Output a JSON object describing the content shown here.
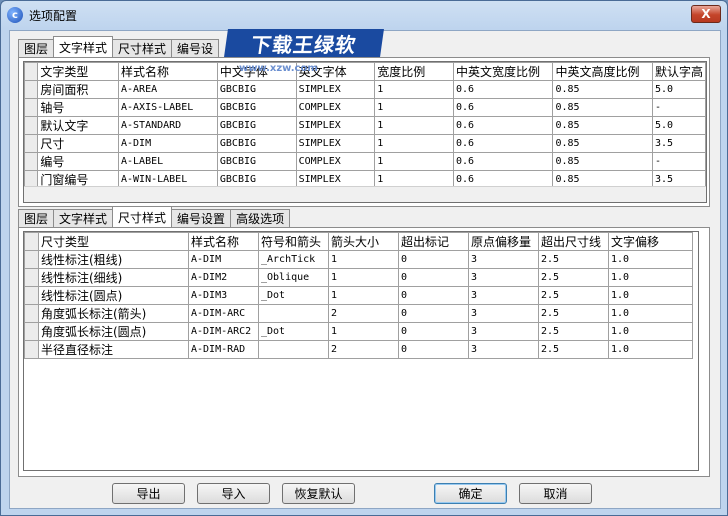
{
  "window": {
    "title": "选项配置",
    "close_label": "X",
    "app_icon": "c"
  },
  "watermark": {
    "text": "下载王绿软",
    "url": "www.xzw.com"
  },
  "top_tabs": [
    "图层",
    "文字样式",
    "尺寸样式",
    "编号设"
  ],
  "text_table": {
    "headers": [
      "文字类型",
      "样式名称",
      "中文字体",
      "英文字体",
      "宽度比例",
      "中英文宽度比例",
      "中英文高度比例",
      "默认字高"
    ],
    "rows": [
      [
        "房间面积",
        "A-AREA",
        "GBCBIG",
        "SIMPLEX",
        "1",
        "0.6",
        "0.85",
        "5.0"
      ],
      [
        "轴号",
        "A-AXIS-LABEL",
        "GBCBIG",
        "COMPLEX",
        "1",
        "0.6",
        "0.85",
        "-"
      ],
      [
        "默认文字",
        "A-STANDARD",
        "GBCBIG",
        "SIMPLEX",
        "1",
        "0.6",
        "0.85",
        "5.0"
      ],
      [
        "尺寸",
        "A-DIM",
        "GBCBIG",
        "SIMPLEX",
        "1",
        "0.6",
        "0.85",
        "3.5"
      ],
      [
        "编号",
        "A-LABEL",
        "GBCBIG",
        "COMPLEX",
        "1",
        "0.6",
        "0.85",
        "-"
      ],
      [
        "门窗编号",
        "A-WIN-LABEL",
        "GBCBIG",
        "SIMPLEX",
        "1",
        "0.6",
        "0.85",
        "3.5"
      ]
    ]
  },
  "bottom_tabs": [
    "图层",
    "文字样式",
    "尺寸样式",
    "编号设置",
    "高级选项"
  ],
  "dim_table": {
    "headers": [
      "尺寸类型",
      "样式名称",
      "符号和箭头",
      "箭头大小",
      "超出标记",
      "原点偏移量",
      "超出尺寸线",
      "文字偏移"
    ],
    "rows": [
      [
        "线性标注(粗线)",
        "A-DIM",
        "_ArchTick",
        "1",
        "0",
        "3",
        "2.5",
        "1.0"
      ],
      [
        "线性标注(细线)",
        "A-DIM2",
        "_Oblique",
        "1",
        "0",
        "3",
        "2.5",
        "1.0"
      ],
      [
        "线性标注(圆点)",
        "A-DIM3",
        "_Dot",
        "1",
        "0",
        "3",
        "2.5",
        "1.0"
      ],
      [
        "角度弧长标注(箭头)",
        "A-DIM-ARC",
        "",
        "2",
        "0",
        "3",
        "2.5",
        "1.0"
      ],
      [
        "角度弧长标注(圆点)",
        "A-DIM-ARC2",
        "_Dot",
        "1",
        "0",
        "3",
        "2.5",
        "1.0"
      ],
      [
        "半径直径标注",
        "A-DIM-RAD",
        "",
        "2",
        "0",
        "3",
        "2.5",
        "1.0"
      ]
    ]
  },
  "buttons": {
    "export": "导出",
    "import": "导入",
    "restore": "恢复默认",
    "ok": "确定",
    "cancel": "取消"
  }
}
